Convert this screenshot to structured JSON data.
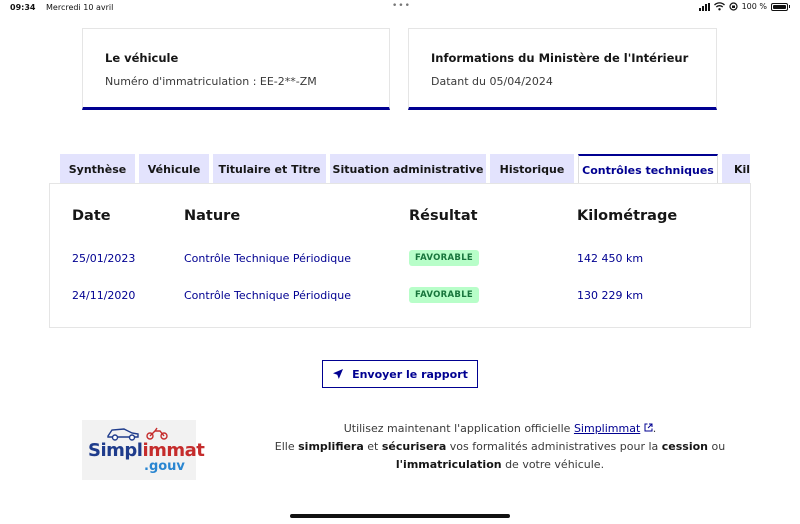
{
  "statusbar": {
    "time": "09:34",
    "date": "Mercredi 10 avril",
    "battery": "100 %"
  },
  "cards": {
    "vehicle": {
      "title": "Le véhicule",
      "text": "Numéro d'immatriculation : EE-2**-ZM"
    },
    "ministere": {
      "title": "Informations du Ministère de l'Intérieur",
      "text": "Datant du 05/04/2024"
    }
  },
  "tabs": [
    {
      "label": "Synthèse"
    },
    {
      "label": "Véhicule"
    },
    {
      "label": "Titulaire et Titre"
    },
    {
      "label": "Situation administrative"
    },
    {
      "label": "Historique"
    },
    {
      "label": "Contrôles techniques",
      "active": true
    },
    {
      "label": "Kilo"
    }
  ],
  "table": {
    "headers": [
      "Date",
      "Nature",
      "Résultat",
      "Kilométrage"
    ],
    "rows": [
      {
        "date": "25/01/2023",
        "nature": "Contrôle Technique Périodique",
        "result": "FAVORABLE",
        "km": "142 450 km"
      },
      {
        "date": "24/11/2020",
        "nature": "Contrôle Technique Périodique",
        "result": "FAVORABLE",
        "km": "130 229 km"
      }
    ]
  },
  "send_button": {
    "label": "Envoyer le rapport"
  },
  "logo": {
    "word_a": "Simpl",
    "word_b": "immat",
    "suffix": ".gouv"
  },
  "promo": {
    "line1_prefix": "Utilisez maintenant l'application officielle ",
    "link": "Simplimmat",
    "line1_suffix": ".",
    "l2_a": "Elle ",
    "l2_b": "simplifiera",
    "l2_c": " et ",
    "l2_d": "sécurisera",
    "l2_e": " vos formalités administratives pour la ",
    "l2_f": "cession",
    "l2_g": " ou",
    "l3_a": "l'immatriculation",
    "l3_b": " de votre véhicule."
  },
  "colors": {
    "primary": "#000091",
    "tab_bg": "#e3e3fd",
    "badge_bg": "#b8fec9",
    "badge_text": "#18753c"
  }
}
